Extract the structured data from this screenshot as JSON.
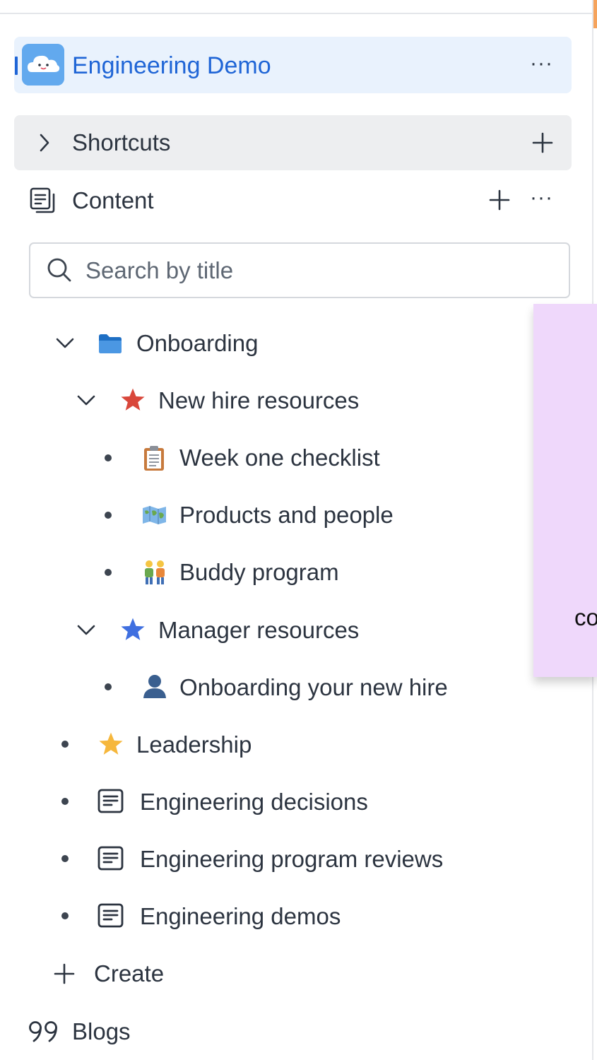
{
  "space": {
    "title": "Engineering Demo",
    "more_icon": "more-horizontal-icon",
    "avatar_icon": "cloud-avatar-icon",
    "accent_color": "#1f65d6",
    "header_bg": "#e9f2fd"
  },
  "shortcuts": {
    "label": "Shortcuts",
    "expand_icon": "chevron-right-icon",
    "add_icon": "plus-icon"
  },
  "content": {
    "label": "Content",
    "icon": "content-pages-icon",
    "add_icon": "plus-icon",
    "more_icon": "more-horizontal-icon"
  },
  "search": {
    "placeholder": "Search by title",
    "icon": "search-icon"
  },
  "tree": {
    "onboarding": {
      "label": "Onboarding",
      "icon": "folder-icon"
    },
    "new_hire_resources": {
      "label": "New hire resources",
      "icon": "red-star-icon"
    },
    "week_one_checklist": {
      "label": "Week one checklist",
      "icon": "clipboard-icon"
    },
    "products_and_people": {
      "label": "Products and people",
      "icon": "world-map-icon"
    },
    "buddy_program": {
      "label": "Buddy program",
      "icon": "two-people-icon"
    },
    "manager_resources": {
      "label": "Manager resources",
      "icon": "blue-star-icon"
    },
    "onboarding_new_hire": {
      "label": "Onboarding your new hire",
      "icon": "person-silhouette-icon"
    },
    "leadership": {
      "label": "Leadership",
      "icon": "yellow-star-icon"
    },
    "engineering_decisions": {
      "label": "Engineering decisions",
      "icon": "page-icon"
    },
    "engineering_program_reviews": {
      "label": "Engineering program reviews",
      "icon": "page-icon"
    },
    "engineering_demos": {
      "label": "Engineering demos",
      "icon": "page-icon"
    }
  },
  "create": {
    "label": "Create",
    "icon": "plus-icon"
  },
  "blogs": {
    "label": "Blogs",
    "icon": "quote-icon"
  },
  "overlay": {
    "text": "co",
    "bg": "#efd8fb"
  }
}
